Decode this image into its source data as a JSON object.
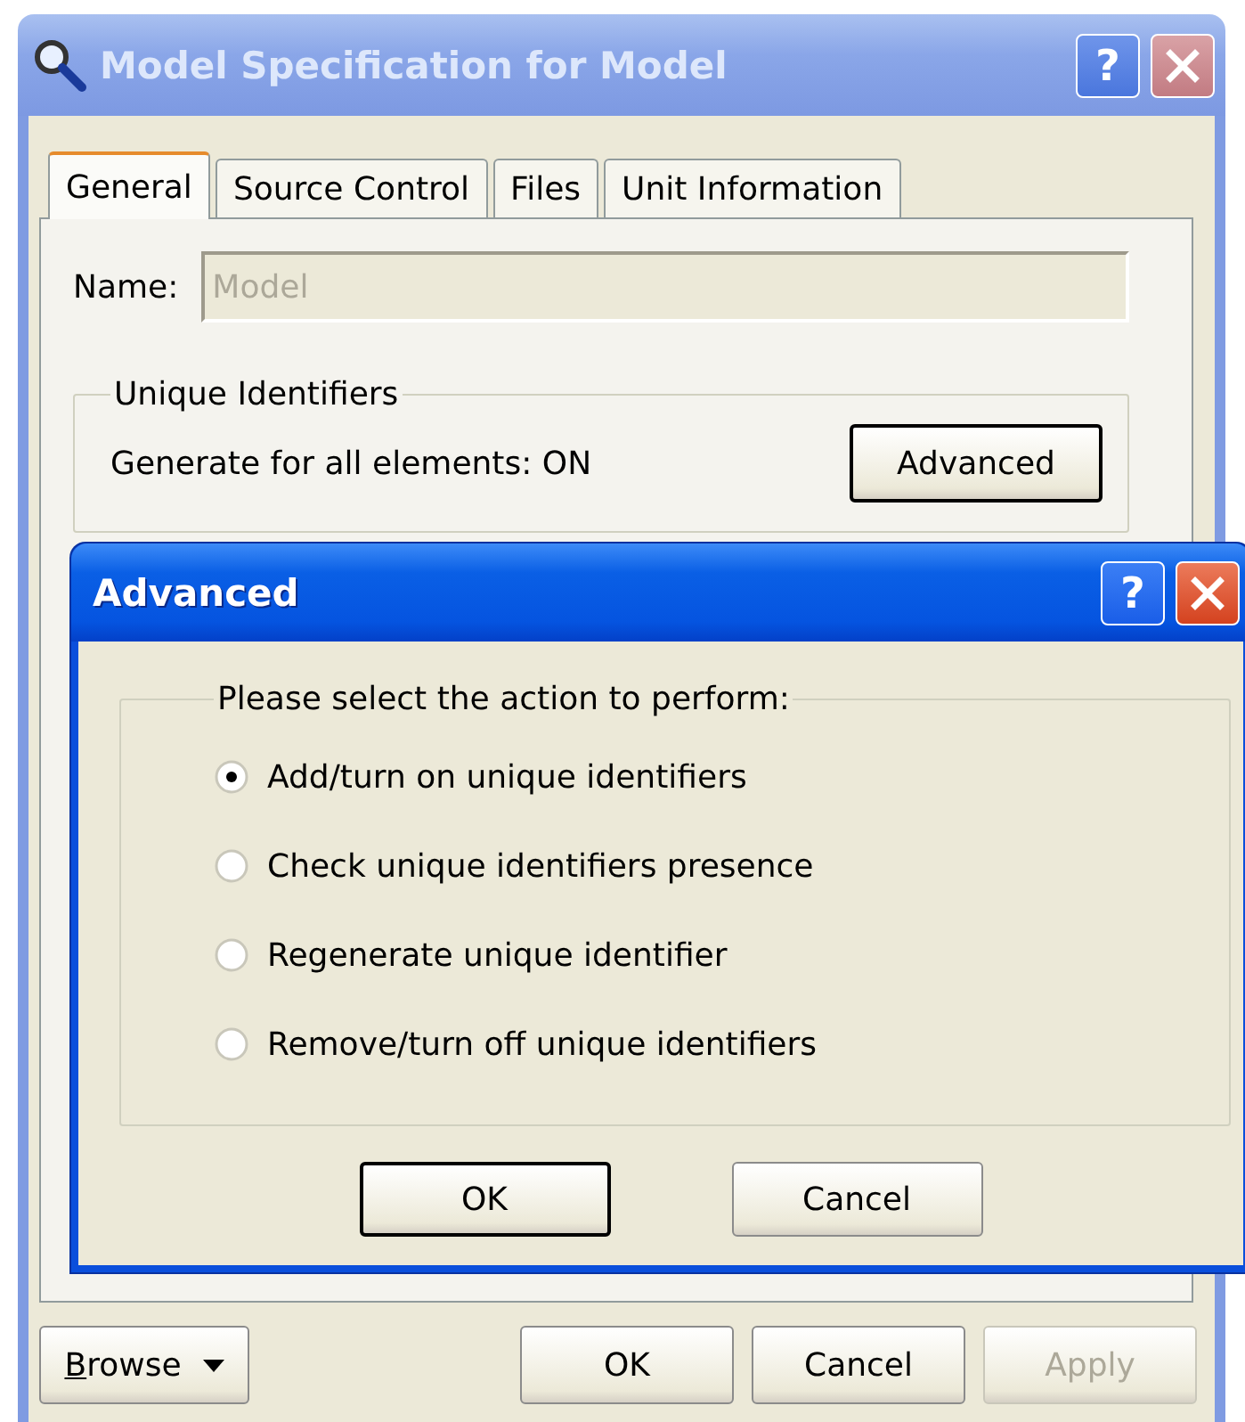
{
  "main_window": {
    "title": "Model Specification for Model",
    "active": false,
    "help_button": "?",
    "tabs": [
      {
        "label": "General",
        "selected": true
      },
      {
        "label": "Source Control",
        "selected": false
      },
      {
        "label": "Files",
        "selected": false
      },
      {
        "label": "Unit Information",
        "selected": false
      }
    ],
    "name_field": {
      "label": "Name:",
      "value": "Model",
      "disabled": true
    },
    "unique_identifiers": {
      "title": "Unique Identifiers",
      "status": "Generate for all elements: ON",
      "button": "Advanced"
    },
    "buttons": [
      {
        "kind": "menu",
        "label": "Browse",
        "disabled": false
      },
      {
        "kind": "push",
        "label": "OK",
        "disabled": false
      },
      {
        "kind": "push",
        "label": "Cancel",
        "disabled": false
      },
      {
        "kind": "push",
        "label": "Apply",
        "disabled": true
      }
    ]
  },
  "dialog": {
    "title": "Advanced",
    "active": true,
    "help_button": "?",
    "group_title": "Please select the action to perform:",
    "options": [
      {
        "label": "Add/turn on unique identifiers",
        "selected": true
      },
      {
        "label": "Check unique identifiers presence",
        "selected": false
      },
      {
        "label": "Regenerate unique identifier",
        "selected": false
      },
      {
        "label": "Remove/turn off unique identifiers",
        "selected": false
      }
    ],
    "buttons": [
      {
        "label": "OK",
        "default": true
      },
      {
        "label": "Cancel",
        "default": false
      }
    ]
  }
}
